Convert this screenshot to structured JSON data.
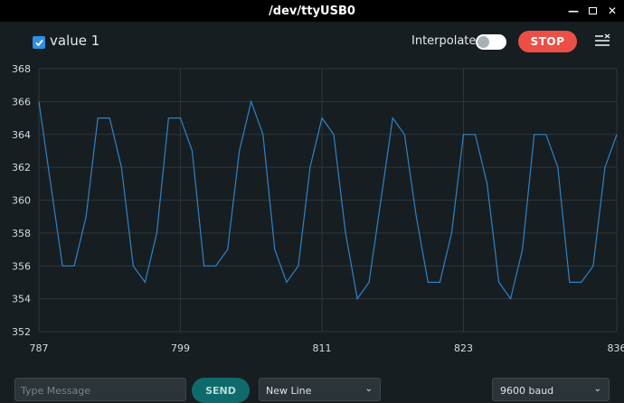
{
  "window": {
    "title": "/dev/ttyUSB0"
  },
  "toolbar": {
    "series_label": "value 1",
    "series_checked": true,
    "interpolate_label": "Interpolate",
    "interpolate_on": false,
    "stop_label": "STOP"
  },
  "bottom": {
    "message_placeholder": "Type Message",
    "send_label": "SEND",
    "line_ending": "New Line",
    "baud_rate": "9600 baud"
  },
  "colors": {
    "line": "#2f82c8",
    "stop": "#eb4f45",
    "accent": "#2f8fe0"
  },
  "chart_data": {
    "type": "line",
    "x": [
      787,
      788,
      789,
      790,
      791,
      792,
      793,
      794,
      795,
      796,
      797,
      798,
      799,
      800,
      801,
      802,
      803,
      804,
      805,
      806,
      807,
      808,
      809,
      810,
      811,
      812,
      813,
      814,
      815,
      816,
      817,
      818,
      819,
      820,
      821,
      822,
      823,
      824,
      825,
      826,
      827,
      828,
      829,
      830,
      831,
      832,
      833,
      834,
      835,
      836
    ],
    "series": [
      {
        "values": [
          366,
          361,
          356,
          356,
          359,
          365,
          365,
          362,
          356,
          355,
          358,
          365,
          365,
          363,
          356,
          356,
          357,
          363,
          366,
          364,
          357,
          355,
          356,
          362,
          365,
          364,
          358,
          354,
          355,
          360,
          365,
          364,
          359,
          355,
          355,
          358,
          364,
          364,
          361,
          355,
          354,
          357,
          364,
          364,
          362,
          355,
          355,
          356,
          362,
          364
        ]
      }
    ],
    "xlim": [
      787,
      836
    ],
    "ylim": [
      352,
      368
    ],
    "x_ticks": [
      787,
      799,
      811,
      823,
      836
    ],
    "y_ticks": [
      352,
      354,
      356,
      358,
      360,
      362,
      364,
      366,
      368
    ],
    "grid": true
  }
}
